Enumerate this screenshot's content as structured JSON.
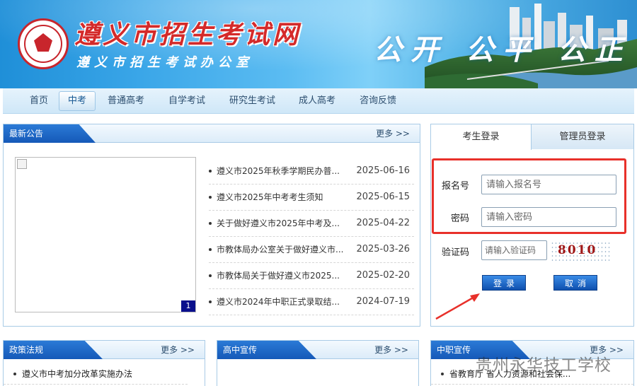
{
  "banner": {
    "title": "遵义市招生考试网",
    "subtitle": "遵义市招生考试办公室",
    "slogan": "公开 公平 公正"
  },
  "nav": {
    "items": [
      "首页",
      "中考",
      "普通高考",
      "自学考试",
      "研究生考试",
      "成人高考",
      "咨询反馈"
    ],
    "active": "中考"
  },
  "announcements": {
    "title": "最新公告",
    "more": "更多 >>",
    "image_page": "1",
    "items": [
      {
        "title": "遵义市2025年秋季学期民办普...",
        "date": "2025-06-16"
      },
      {
        "title": "遵义市2025年中考考生须知",
        "date": "2025-06-15"
      },
      {
        "title": "关于做好遵义市2025年中考及...",
        "date": "2025-04-22"
      },
      {
        "title": "市教体局办公室关于做好遵义市...",
        "date": "2025-03-26"
      },
      {
        "title": "市教体局关于做好遵义市2025...",
        "date": "2025-02-20"
      },
      {
        "title": "遵义市2024年中职正式录取结...",
        "date": "2024-07-19"
      }
    ]
  },
  "login": {
    "tabs": [
      "考生登录",
      "管理员登录"
    ],
    "username_label": "报名号",
    "username_placeholder": "请输入报名号",
    "password_label": "密码",
    "password_placeholder": "请输入密码",
    "captcha_label": "验证码",
    "captcha_placeholder": "请输入验证码",
    "captcha_code": "8010",
    "login_button": "登录",
    "cancel_button": "取消"
  },
  "policy": {
    "title": "政策法规",
    "more": "更多 >>",
    "items": [
      "遵义市中考加分改革实施办法"
    ]
  },
  "highschool": {
    "title": "高中宣传",
    "more": "更多 >>"
  },
  "vocational": {
    "title": "中职宣传",
    "more": "更多 >>",
    "items": [
      "省教育厅 省人力资源和社会保..."
    ]
  },
  "watermark": "贵州永华技工学校",
  "colors": {
    "accent": "#1559b8",
    "highlight_border": "#e8302a",
    "title_red": "#d42a2a"
  }
}
